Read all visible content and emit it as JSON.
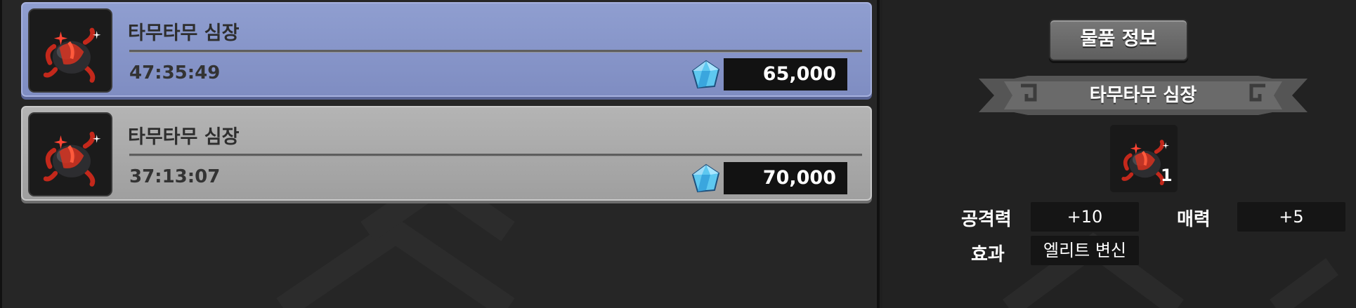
{
  "listings": [
    {
      "name": "타무타무 심장",
      "time": "47:35:49",
      "price": "65,000"
    },
    {
      "name": "타무타무 심장",
      "time": "37:13:07",
      "price": "70,000"
    }
  ],
  "detail": {
    "info_button": "물품 정보",
    "item_name": "타무타무 심장",
    "quantity": "1",
    "stats": [
      {
        "label": "공격력",
        "value": "+10"
      },
      {
        "label": "매력",
        "value": "+5"
      },
      {
        "label": "효과",
        "value": "엘리트 변신"
      }
    ]
  },
  "colors": {
    "selected_row": "#8794c9",
    "normal_row": "#aaaaaa",
    "gem": "#5ec8f0",
    "item_red": "#d6311f"
  },
  "icons": [
    "tamutamu-heart-icon",
    "diamond-gem-icon"
  ]
}
